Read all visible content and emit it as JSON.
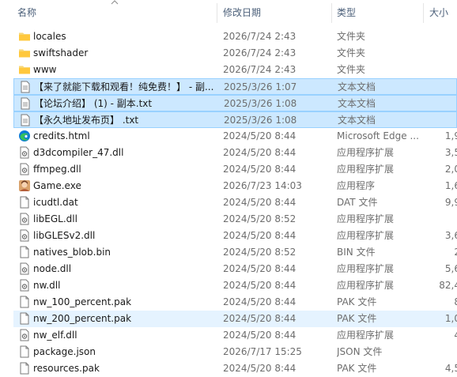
{
  "columns": {
    "name": "名称",
    "date": "修改日期",
    "type": "类型",
    "size": "大小"
  },
  "sort_indicator": "up-chevron-icon",
  "files": [
    {
      "name": "locales",
      "date": "2026/7/24 2:43",
      "type": "文件夹",
      "size": "",
      "icon": "folder-icon",
      "state": "normal"
    },
    {
      "name": "swiftshader",
      "date": "2026/7/24 2:43",
      "type": "文件夹",
      "size": "",
      "icon": "folder-icon",
      "state": "normal"
    },
    {
      "name": "www",
      "date": "2026/7/24 2:43",
      "type": "文件夹",
      "size": "",
      "icon": "folder-icon",
      "state": "normal"
    },
    {
      "name": "【来了就能下载和观看！纯免费！】 - 副...",
      "date": "2025/3/26 1:07",
      "type": "文本文档",
      "size": "",
      "icon": "text-file-icon",
      "state": "selected"
    },
    {
      "name": "【论坛介绍】 (1) - 副本.txt",
      "date": "2025/3/26 1:08",
      "type": "文本文档",
      "size": "",
      "icon": "text-file-icon",
      "state": "selected"
    },
    {
      "name": "【永久地址发布页】 .txt",
      "date": "2025/3/26 1:08",
      "type": "文本文档",
      "size": "",
      "icon": "text-file-icon",
      "state": "selected"
    },
    {
      "name": "credits.html",
      "date": "2024/5/20 8:44",
      "type": "Microsoft Edge ...",
      "size": "1,9",
      "icon": "edge-icon",
      "state": "normal"
    },
    {
      "name": "d3dcompiler_47.dll",
      "date": "2024/5/20 8:44",
      "type": "应用程序扩展",
      "size": "3,5",
      "icon": "dll-file-icon",
      "state": "normal"
    },
    {
      "name": "ffmpeg.dll",
      "date": "2024/5/20 8:44",
      "type": "应用程序扩展",
      "size": "2,0",
      "icon": "dll-file-icon",
      "state": "normal"
    },
    {
      "name": "Game.exe",
      "date": "2026/7/23 14:03",
      "type": "应用程序",
      "size": "1,6",
      "icon": "game-app-icon",
      "state": "normal"
    },
    {
      "name": "icudtl.dat",
      "date": "2024/5/20 8:44",
      "type": "DAT 文件",
      "size": "9,9",
      "icon": "file-icon",
      "state": "normal"
    },
    {
      "name": "libEGL.dll",
      "date": "2024/5/20 8:52",
      "type": "应用程序扩展",
      "size": "",
      "icon": "dll-file-icon",
      "state": "normal"
    },
    {
      "name": "libGLESv2.dll",
      "date": "2024/5/20 8:44",
      "type": "应用程序扩展",
      "size": "3,6",
      "icon": "dll-file-icon",
      "state": "normal"
    },
    {
      "name": "natives_blob.bin",
      "date": "2024/5/20 8:52",
      "type": "BIN 文件",
      "size": "2",
      "icon": "file-icon",
      "state": "normal"
    },
    {
      "name": "node.dll",
      "date": "2024/5/20 8:44",
      "type": "应用程序扩展",
      "size": "5,6",
      "icon": "dll-file-icon",
      "state": "normal"
    },
    {
      "name": "nw.dll",
      "date": "2024/5/20 8:44",
      "type": "应用程序扩展",
      "size": "82,4",
      "icon": "dll-file-icon",
      "state": "normal"
    },
    {
      "name": "nw_100_percent.pak",
      "date": "2024/5/20 8:44",
      "type": "PAK 文件",
      "size": "8",
      "icon": "file-icon",
      "state": "normal"
    },
    {
      "name": "nw_200_percent.pak",
      "date": "2024/5/20 8:44",
      "type": "PAK 文件",
      "size": "1,0",
      "icon": "file-icon",
      "state": "hover"
    },
    {
      "name": "nw_elf.dll",
      "date": "2024/5/20 8:44",
      "type": "应用程序扩展",
      "size": "4",
      "icon": "dll-file-icon",
      "state": "normal"
    },
    {
      "name": "package.json",
      "date": "2026/7/17 15:25",
      "type": "JSON 文件",
      "size": "",
      "icon": "file-icon",
      "state": "normal"
    },
    {
      "name": "resources.pak",
      "date": "2024/5/20 8:44",
      "type": "PAK 文件",
      "size": "4,5",
      "icon": "file-icon",
      "state": "normal"
    }
  ]
}
